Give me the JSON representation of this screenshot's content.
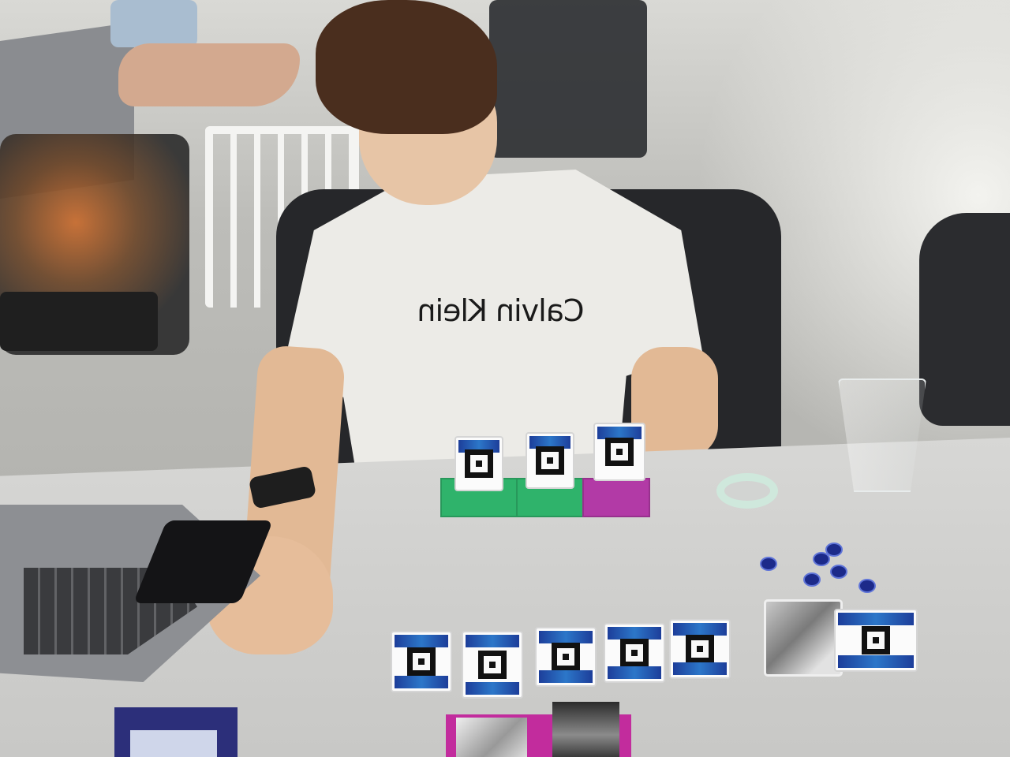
{
  "scene": {
    "shirt_brand_text": "Calvin Klein"
  }
}
